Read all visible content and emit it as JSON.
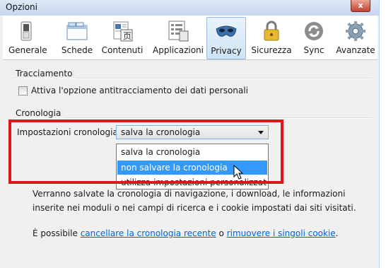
{
  "window": {
    "title": "Opzioni",
    "close_glyph": "x"
  },
  "toolbar": {
    "items": [
      {
        "label": "Generale",
        "icon": "switch-icon"
      },
      {
        "label": "Schede",
        "icon": "tabs-icon"
      },
      {
        "label": "Contenuti",
        "icon": "content-icon"
      },
      {
        "label": "Applicazioni",
        "icon": "applications-icon"
      },
      {
        "label": "Privacy",
        "icon": "mask-icon",
        "active": true
      },
      {
        "label": "Sicurezza",
        "icon": "padlock-icon"
      },
      {
        "label": "Sync",
        "icon": "sync-icon"
      },
      {
        "label": "Avanzate",
        "icon": "gear-icon"
      }
    ]
  },
  "tracking": {
    "title": "Tracciamento",
    "checkbox_label": "Attiva l'opzione antitracciamento dei dati personali",
    "checked": false
  },
  "history": {
    "title": "Cronologia",
    "settings_label": "Impostazioni cronologia:",
    "selected_value": "salva la cronologia",
    "options": [
      "salva la cronologia",
      "non salvare la cronologia",
      "utilizza impostazioni personalizzate"
    ],
    "highlighted_index": 1,
    "description": "Verranno salvate la cronologia di navigazione, i download, le informazioni inserite nei moduli o nei campi di ricerca e i cookie impostati dai siti visitati.",
    "links_prefix": "È possibile ",
    "link_clear": "cancellare la cronologia recente",
    "links_middle": " o ",
    "link_remove_cookies": "rimuovere i singoli cookie",
    "links_suffix": "."
  },
  "colors": {
    "highlight_red": "#e0141c",
    "selection_blue": "#3399ff",
    "link": "#0066cc"
  }
}
